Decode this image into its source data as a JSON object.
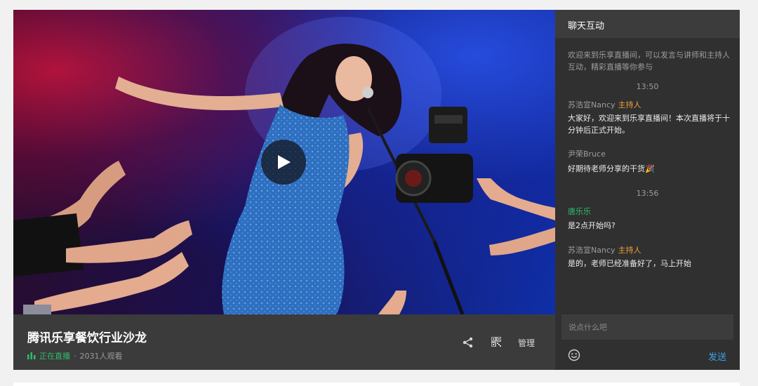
{
  "video": {
    "title": "腾讯乐享餐饮行业沙龙",
    "live_status": "正在直播",
    "separator": "·",
    "viewers": "2031人观看",
    "manage_label": "管理",
    "icons": [
      "share-icon",
      "qrcode-icon",
      "play-icon",
      "live-bars-icon"
    ]
  },
  "chat": {
    "header": "聊天互动",
    "welcome": "欢迎来到乐享直播间，可以发言与讲师和主持人互动，精彩直播等你参与",
    "messages": [
      {
        "time": "13:50",
        "sender": "苏浩宣Nancy",
        "role": "主持人",
        "text": "大家好，欢迎来到乐享直播间！本次直播将于十分钟后正式开始。"
      },
      {
        "sender": "尹荣Bruce",
        "text": "好期待老师分享的干货🎉"
      },
      {
        "time": "13:56",
        "sender": "唐乐乐",
        "text": "是2点开始吗?"
      },
      {
        "sender": "苏浩宣Nancy",
        "role": "主持人",
        "text": "是的，老师已经准备好了，马上开始"
      }
    ],
    "input_placeholder": "说点什么吧",
    "send_label": "发送",
    "icons": [
      "emoji-icon"
    ]
  },
  "colors": {
    "live_green": "#2ebd6b",
    "host_orange": "#f0a23a",
    "send_blue": "#3aa0e8",
    "chat_bg": "#303030",
    "info_bar_bg": "#3b3b3b"
  }
}
